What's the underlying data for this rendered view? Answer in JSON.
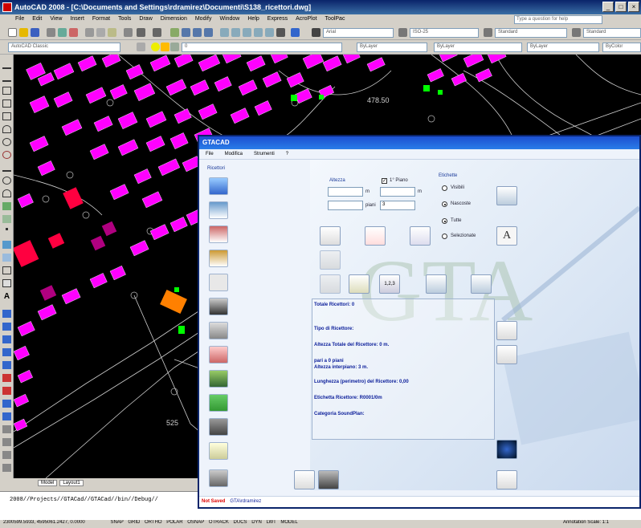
{
  "acad": {
    "title": "AutoCAD 2008 - [C:\\Documents and Settings\\rdramirez\\Documenti\\S138_ricettori.dwg]",
    "menus": [
      "File",
      "Edit",
      "View",
      "Insert",
      "Format",
      "Tools",
      "Draw",
      "Dimension",
      "Modify",
      "Window",
      "Help",
      "Express",
      "AcroPlot",
      "ToolPac"
    ],
    "help_placeholder": "Type a question for help",
    "toolbar": {
      "font": "Arial",
      "iso": "ISO-25",
      "style1": "Standard",
      "style2": "Standard",
      "workspace": "AutoCAD Classic",
      "layer": "0",
      "color": "ByLayer",
      "linetype": "ByLayer",
      "lineweight": "ByLayer",
      "plotstyle": "ByColor"
    },
    "tabs": [
      "Model",
      "Layout1"
    ],
    "command_text": "2008//Projects//GTACad//GTACad//bin//Debug//",
    "drawing_labels": [
      "478.50",
      "525"
    ],
    "status": {
      "coords": "2300599.5933, 4595061.2427, 0.0000",
      "toggles": [
        "SNAP",
        "GRID",
        "ORTHO",
        "POLAR",
        "OSNAP",
        "OTRACK",
        "DUCS",
        "DYN",
        "LWT",
        "MODEL"
      ],
      "annotation_scale": "Annotation Scale: 1:1"
    }
  },
  "gta": {
    "title": "GTACAD",
    "menus": [
      "File",
      "Modifica",
      "Strumenti",
      "?"
    ],
    "ricettori_label": "Ricettori",
    "altezza_label": "Altezza",
    "unit_m": "m",
    "unit_m2": "m",
    "piani_label": "piani",
    "piani_value": "3",
    "primo_piano_label": "1° Piano",
    "etichette_label": "Etichette",
    "radio_visibili": "Visibili",
    "radio_nascoste": "Nascoste",
    "radio_tutte": "Tutte",
    "radio_selezionate": "Selezionate",
    "info": {
      "totale": "Totale Ricettori: 0",
      "tipo": "Tipo di Ricettore:",
      "altezza_totale": "Altezza Totale del Ricettore: 0 m.",
      "pari": "pari a 0 piani",
      "interpiano": "Altezza interpiano: 3 m.",
      "lunghezza": "Lunghezza (perimetro) del Ricettore: 0,00",
      "etichetta": "Etichetta Ricettore: R0001/0m",
      "categoria": "Categoria SoundPlan:"
    },
    "watermark": "GTA",
    "status_not_saved": "Not Saved",
    "status_user": "GTA\\rdramirez",
    "colors": {
      "accent": "#1c4fd0",
      "info_text": "#0b1e9a",
      "magenta": "#ff00ff"
    }
  }
}
